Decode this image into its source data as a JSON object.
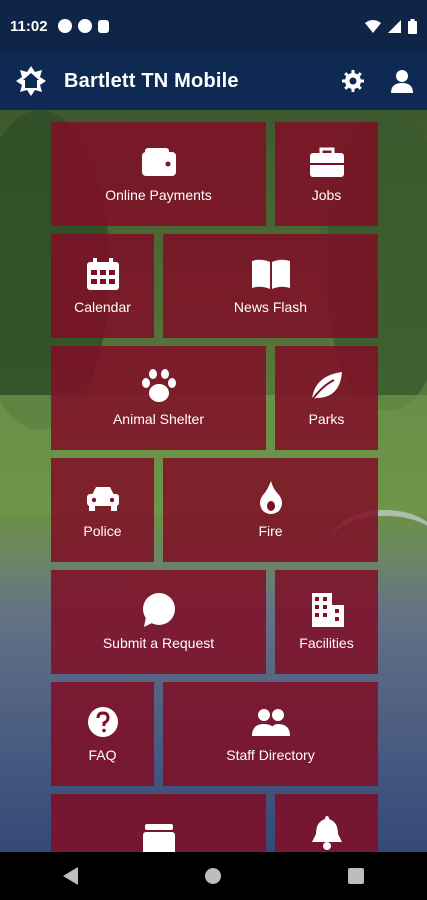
{
  "status_bar": {
    "time": "11:02"
  },
  "app_bar": {
    "title": "Bartlett TN Mobile"
  },
  "tiles": [
    {
      "label": "Online Payments",
      "icon": "wallet-icon"
    },
    {
      "label": "Jobs",
      "icon": "briefcase-icon"
    },
    {
      "label": "Calendar",
      "icon": "calendar-icon"
    },
    {
      "label": "News Flash",
      "icon": "book-icon"
    },
    {
      "label": "Animal Shelter",
      "icon": "paw-icon"
    },
    {
      "label": "Parks",
      "icon": "leaf-icon"
    },
    {
      "label": "Police",
      "icon": "car-icon"
    },
    {
      "label": "Fire",
      "icon": "flame-icon"
    },
    {
      "label": "Submit a Request",
      "icon": "chat-bubble-icon"
    },
    {
      "label": "Facilities",
      "icon": "building-icon"
    },
    {
      "label": "FAQ",
      "icon": "question-icon"
    },
    {
      "label": "Staff Directory",
      "icon": "people-icon"
    },
    {
      "label": "",
      "icon": "archive-icon"
    },
    {
      "label": "",
      "icon": "bell-icon"
    }
  ],
  "colors": {
    "tile": "#800e26",
    "app_bar": "#0e2a52",
    "status_bar": "#0e2547"
  }
}
